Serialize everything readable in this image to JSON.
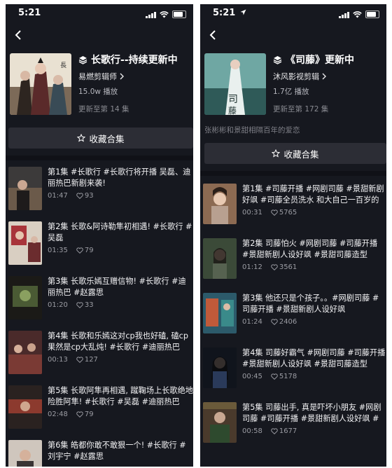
{
  "left": {
    "status": {
      "time": "5:21"
    },
    "series": {
      "title": "长歌行--持续更新中",
      "author": "易燃剪辑师",
      "plays": "15.0w 播放",
      "updated": "更新至第 14 集"
    },
    "collect_label": "收藏合集",
    "episodes": [
      {
        "text": "第1集  #长歌行  #长歌行将开播 吴磊、迪丽热巴新剧来袭!",
        "time": "01:47",
        "likes": "93"
      },
      {
        "text": "第2集  长歌&阿诗勒隼初相遇! #长歌行 #吴磊",
        "time": "01:35",
        "likes": "79"
      },
      {
        "text": "第3集  长歌乐嫣互赠信物! #长歌行 #迪丽热巴 #赵露思",
        "time": "01:20",
        "likes": "33"
      },
      {
        "text": "第4集  长歌和乐嫣这对cp我也好磕, 磕cp果然是cp大乱炖! #长歌行 #迪丽热巴",
        "time": "00:13",
        "likes": "127"
      },
      {
        "text": "第5集  长歌阿隼再相遇, 蹴鞠场上长歌绝地险胜阿隼! #长歌行 #吴磊 #迪丽热巴",
        "time": "02:48",
        "likes": "79"
      },
      {
        "text": "第6集  皓都你敢不敢狠一个! #长歌行 #刘宇宁 #赵露思",
        "time": "",
        "likes": ""
      }
    ]
  },
  "right": {
    "status": {
      "time": "5:21"
    },
    "series": {
      "title": "《司藤》更新中",
      "author": "沐风影视剪辑",
      "plays": "1.7亿 播放",
      "updated": "更新至第 172 集",
      "description": "张彬彬和景甜相隔百年的爱恋"
    },
    "collect_label": "收藏合集",
    "episodes": [
      {
        "text": "第1集  #司藤开播 #网剧司藤 #景甜新剧好飒 #司藤全员洗水 和大自己一百岁的美",
        "time": "00:31",
        "likes": "5765"
      },
      {
        "text": "第2集  司藤怕火 #网剧司藤 #司藤开播 #景甜新剧人设好飒 #景甜司藤造型",
        "time": "01:12",
        "likes": "3561"
      },
      {
        "text": "第3集  他还只是个孩子。。#网剧司藤 #司藤开播 #景甜新剧人设好飒",
        "time": "01:24",
        "likes": "2406"
      },
      {
        "text": "第4集  司藤好霸气 #网剧司藤 #司藤开播 #景甜新剧人设好飒 #景甜司藤造型",
        "time": "00:45",
        "likes": "5178"
      },
      {
        "text": "第5集  司藤出手, 真是吓坏小朋友 #网剧司藤 #司藤开播 #景甜新剧人设好飒 #景甜",
        "time": "00:58",
        "likes": "1677"
      }
    ]
  }
}
